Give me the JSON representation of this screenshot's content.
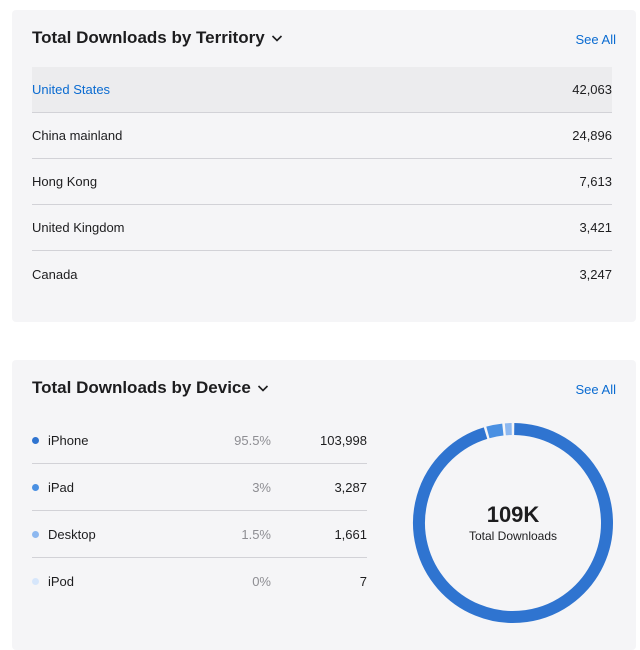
{
  "territory": {
    "title": "Total Downloads by Territory",
    "see_all": "See All",
    "rows": [
      {
        "name": "United States",
        "value": "42,063"
      },
      {
        "name": "China mainland",
        "value": "24,896"
      },
      {
        "name": "Hong Kong",
        "value": "7,613"
      },
      {
        "name": "United Kingdom",
        "value": "3,421"
      },
      {
        "name": "Canada",
        "value": "3,247"
      }
    ]
  },
  "device": {
    "title": "Total Downloads by Device",
    "see_all": "See All",
    "rows": [
      {
        "name": "iPhone",
        "pct": "95.5%",
        "count": "103,998",
        "color": "#2f74d0"
      },
      {
        "name": "iPad",
        "pct": "3%",
        "count": "3,287",
        "color": "#4a90e2"
      },
      {
        "name": "Desktop",
        "pct": "1.5%",
        "count": "1,661",
        "color": "#8db8f0"
      },
      {
        "name": "iPod",
        "pct": "0%",
        "count": "7",
        "color": "#d6e6fb"
      }
    ],
    "donut": {
      "total": "109K",
      "label": "Total Downloads",
      "fractions": [
        0.955,
        0.03,
        0.015,
        0.0001
      ]
    }
  },
  "colors": {
    "accent": "#0a6bd1",
    "card_bg": "#f5f5f7"
  }
}
